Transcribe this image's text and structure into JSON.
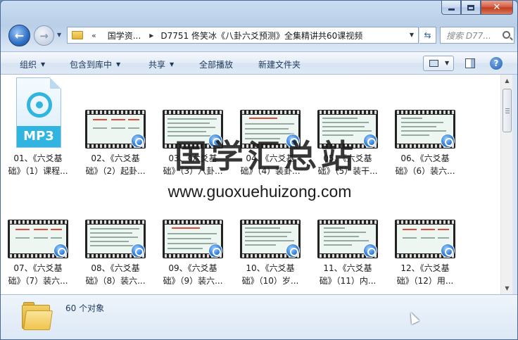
{
  "window": {
    "close_glyph": "✕"
  },
  "nav": {
    "back_glyph": "←",
    "forward_glyph": "→",
    "history_glyph": "▼",
    "breadcrumb_overflow": "«",
    "breadcrumbs": [
      "国学资...",
      "D7751 佟笑冰《八卦六爻预测》全集精讲共60课视频"
    ],
    "search_placeholder": "搜索 D77..."
  },
  "toolbar": {
    "items": [
      "组织",
      "包含到库中",
      "共享",
      "全部播放",
      "新建文件夹"
    ],
    "dropdown_glyph": "▼",
    "help_glyph": "?"
  },
  "files": [
    {
      "line1": "01、《六爻基",
      "line2": "础》（1）课程...",
      "type": "mp3",
      "icon_label": "MP3"
    },
    {
      "line1": "02、《六爻基",
      "line2": "础》（2）起卦...",
      "type": "video"
    },
    {
      "line1": "03、《六爻基",
      "line2": "础》（3）八卦...",
      "type": "video"
    },
    {
      "line1": "04、《六爻基",
      "line2": "础》（4）装卦...",
      "type": "video"
    },
    {
      "line1": "05、《六爻基",
      "line2": "础》（5）装干...",
      "type": "video"
    },
    {
      "line1": "06、《六爻基",
      "line2": "础》（6）装六...",
      "type": "video"
    },
    {
      "line1": "07、《六爻基",
      "line2": "础》（7）装六...",
      "type": "video"
    },
    {
      "line1": "08、《六爻基",
      "line2": "础》（8）装六...",
      "type": "video"
    },
    {
      "line1": "09、《六爻基",
      "line2": "础》（9）装六...",
      "type": "video"
    },
    {
      "line1": "10、《六爻基",
      "line2": "础》（10）岁...",
      "type": "video"
    },
    {
      "line1": "11、《六爻基",
      "line2": "础》（11）内...",
      "type": "video"
    },
    {
      "line1": "12、《六爻基",
      "line2": "础》（12）用...",
      "type": "video"
    }
  ],
  "watermark": {
    "title": "国学汇总站",
    "url": "www.guoxuehuizong.com"
  },
  "status": {
    "item_count": "60 个对象"
  }
}
